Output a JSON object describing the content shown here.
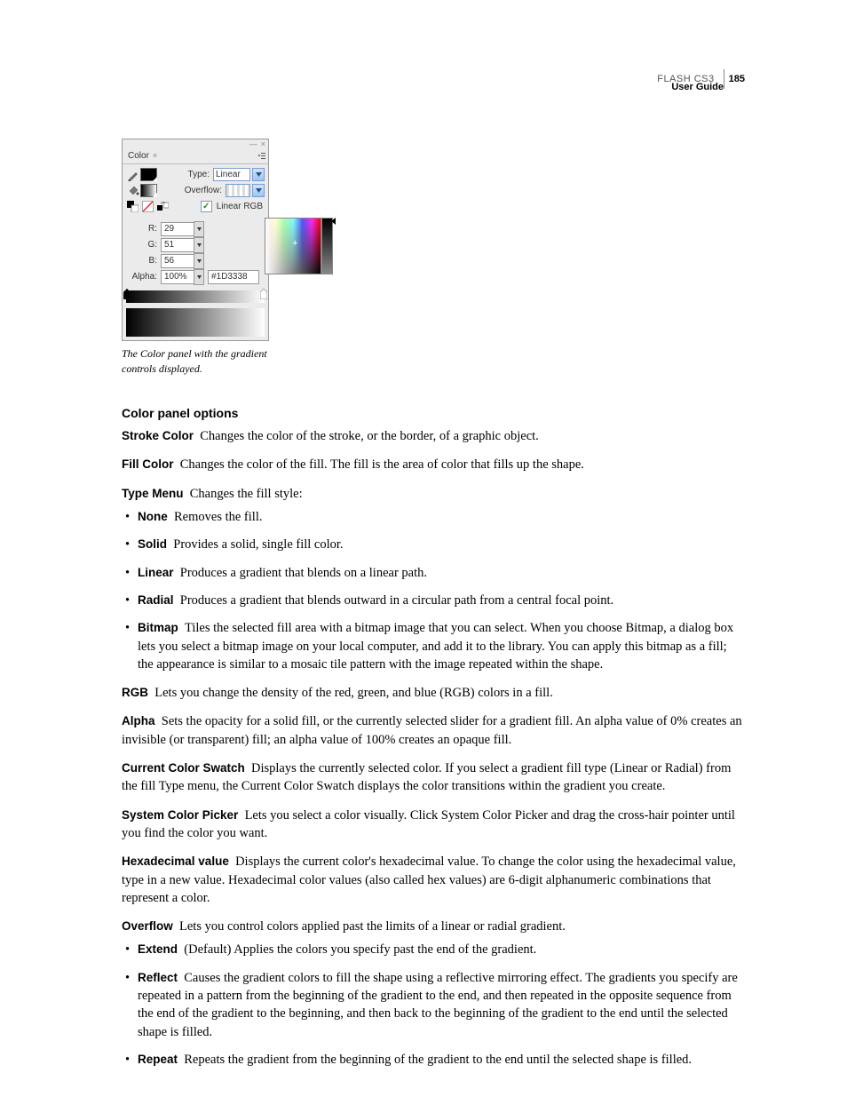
{
  "header": {
    "product": "FLASH CS3",
    "page": "185",
    "subtitle": "User Guide"
  },
  "panel": {
    "tab": "Color",
    "type_label": "Type:",
    "type_value": "Linear",
    "overflow_label": "Overflow:",
    "linear_rgb_label": "Linear RGB",
    "r_label": "R:",
    "g_label": "G:",
    "b_label": "B:",
    "alpha_label": "Alpha:",
    "r_value": "29",
    "g_value": "51",
    "b_value": "56",
    "alpha_value": "100%",
    "hex_value": "#1D3338"
  },
  "caption": "The Color panel with the gradient controls displayed.",
  "section_title": "Color panel options",
  "defs": {
    "stroke_color": {
      "term": "Stroke Color",
      "desc": "Changes the color of the stroke, or the border, of a graphic object."
    },
    "fill_color": {
      "term": "Fill Color",
      "desc": "Changes the color of the fill. The fill is the area of color that fills up the shape."
    },
    "type_menu": {
      "term": "Type Menu",
      "desc": "Changes the fill style:"
    },
    "rgb": {
      "term": "RGB",
      "desc": "Lets you change the density of the red, green, and blue (RGB) colors in a fill."
    },
    "alpha": {
      "term": "Alpha",
      "desc": "Sets the opacity for a solid fill, or the currently selected slider for a gradient fill. An alpha value of 0% creates an invisible (or transparent) fill; an alpha value of 100% creates an opaque fill."
    },
    "current": {
      "term": "Current Color Swatch",
      "desc": "Displays the currently selected color. If you select a gradient fill type (Linear or Radial) from the fill Type menu, the Current Color Swatch displays the color transitions within the gradient you create."
    },
    "system": {
      "term": "System Color Picker",
      "desc": "Lets you select a color visually. Click System Color Picker and drag the cross-hair pointer until you find the color you want."
    },
    "hex": {
      "term": "Hexadecimal value",
      "desc": "Displays the current color's hexadecimal value. To change the color using the hexadecimal value, type in a new value. Hexadecimal color values (also called hex values) are 6-digit alphanumeric combinations that represent a color."
    },
    "overflow": {
      "term": "Overflow",
      "desc": "Lets you control colors applied past the limits of a linear or radial gradient."
    }
  },
  "type_items": {
    "none": {
      "term": "None",
      "desc": "Removes the fill."
    },
    "solid": {
      "term": "Solid",
      "desc": "Provides a solid, single fill color."
    },
    "linear": {
      "term": "Linear",
      "desc": "Produces a gradient that blends on a linear path."
    },
    "radial": {
      "term": "Radial",
      "desc": "Produces a gradient that blends outward in a circular path from a central focal point."
    },
    "bitmap": {
      "term": "Bitmap",
      "desc": "Tiles the selected fill area with a bitmap image that you can select. When you choose Bitmap, a dialog box lets you select a bitmap image on your local computer, and add it to the library. You can apply this bitmap as a fill; the appearance is similar to a mosaic tile pattern with the image repeated within the shape."
    }
  },
  "overflow_items": {
    "extend": {
      "term": "Extend",
      "desc": "(Default) Applies the colors you specify past the end of the gradient."
    },
    "reflect": {
      "term": "Reflect",
      "desc": "Causes the gradient colors to fill the shape using a reflective mirroring effect. The gradients you specify are repeated in a pattern from the beginning of the gradient to the end, and then repeated in the opposite sequence from the end of the gradient to the beginning, and then back to the beginning of the gradient to the end until the selected shape is filled."
    },
    "repeat": {
      "term": "Repeat",
      "desc": "Repeats the gradient from the beginning of the gradient to the end until the selected shape is filled."
    }
  }
}
